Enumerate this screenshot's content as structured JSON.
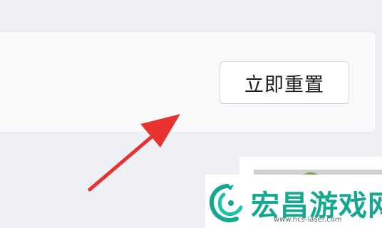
{
  "reset_section": {
    "reset_button_label": "立即重置"
  },
  "annotation": {
    "arrow_color": "#e8322f",
    "arrow_icon": "red-pointer-arrow-icon"
  },
  "watermark": {
    "brand": "宏昌游戏网",
    "url": "www.hcs-laser.com",
    "brand_color": "#13a88f",
    "logo_icon": "dragon-logo-icon"
  }
}
